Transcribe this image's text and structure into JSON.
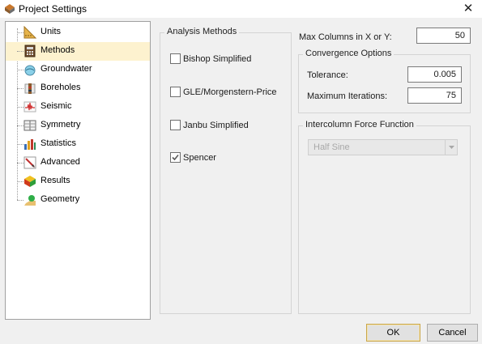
{
  "window": {
    "title": "Project Settings",
    "close_glyph": "✕"
  },
  "nav": {
    "selected": "Methods",
    "items": [
      {
        "label": "Units",
        "icon": "units-icon"
      },
      {
        "label": "Methods",
        "icon": "methods-icon"
      },
      {
        "label": "Groundwater",
        "icon": "groundwater-icon"
      },
      {
        "label": "Boreholes",
        "icon": "boreholes-icon"
      },
      {
        "label": "Seismic",
        "icon": "seismic-icon"
      },
      {
        "label": "Symmetry",
        "icon": "symmetry-icon"
      },
      {
        "label": "Statistics",
        "icon": "statistics-icon"
      },
      {
        "label": "Advanced",
        "icon": "advanced-icon"
      },
      {
        "label": "Results",
        "icon": "results-icon"
      },
      {
        "label": "Geometry",
        "icon": "geometry-icon"
      }
    ]
  },
  "analysis_methods": {
    "label": "Analysis Methods",
    "options": [
      {
        "label": "Bishop Simplified",
        "checked": false
      },
      {
        "label": "GLE/Morgenstern-Price",
        "checked": false
      },
      {
        "label": "Janbu Simplified",
        "checked": false
      },
      {
        "label": "Spencer",
        "checked": true
      }
    ]
  },
  "max_columns": {
    "label": "Max Columns in X or Y:",
    "value": "50"
  },
  "convergence": {
    "label": "Convergence Options",
    "tolerance": {
      "label": "Tolerance:",
      "value": "0.005"
    },
    "max_iterations": {
      "label": "Maximum Iterations:",
      "value": "75"
    }
  },
  "intercolumn": {
    "label": "Intercolumn Force Function",
    "selected": "Half Sine",
    "enabled": false
  },
  "buttons": {
    "ok": "OK",
    "cancel": "Cancel"
  },
  "colors": {
    "selected_row": "#fdf2cf",
    "default_button_border": "#c9a64a",
    "check_mark": "#5b5b5b"
  }
}
